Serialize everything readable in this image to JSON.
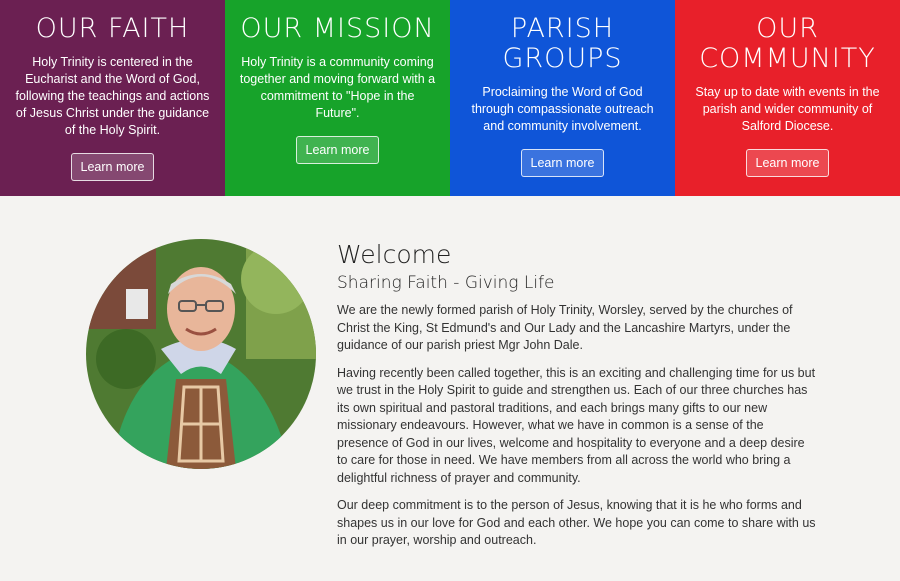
{
  "tiles": [
    {
      "title": "OUR FAITH",
      "text": "Holy Trinity is centered in the Eucharist and the Word of God, following the teachings and actions of Jesus Christ under the guidance of the Holy Spirit.",
      "button": "Learn more",
      "color": "#6b2052"
    },
    {
      "title": "OUR MISSION",
      "text": "Holy Trinity is a community coming together and moving forward with a commitment to \"Hope in the Future\".",
      "button": "Learn more",
      "color": "#17a32a"
    },
    {
      "title": "PARISH GROUPS",
      "text": "Proclaiming the Word of God through compassionate outreach and community involvement.",
      "button": "Learn more",
      "color": "#0f55d8"
    },
    {
      "title": "OUR COMMUNITY",
      "text": "Stay up to date with events in the parish and wider community of Salford Diocese.",
      "button": "Learn more",
      "color": "#e8202a"
    }
  ],
  "welcome": {
    "heading": "Welcome",
    "subheading": "Sharing Faith - Giving Life",
    "paragraphs": [
      "We are the newly formed parish of Holy Trinity, Worsley, served by the churches of Christ the King, St Edmund's and Our Lady and the Lancashire Martyrs, under the guidance of our parish priest Mgr John Dale.",
      "Having recently been called together, this is an exciting and challenging time for us but we trust in the Holy Spirit to guide and strengthen us. Each of our three churches has its own spiritual and pastoral traditions, and each brings many gifts to our new missionary endeavours. However, what we have in common is a sense of the presence of God in our lives, welcome and hospitality to everyone and a deep desire to care for those in need. We have members from all across the world who bring a delightful richness of prayer and community.",
      "Our deep commitment is to the person of Jesus, knowing that it is he who forms and shapes us in our love for God and each other. We hope you can come to share with us in our prayer, worship and outreach."
    ]
  }
}
